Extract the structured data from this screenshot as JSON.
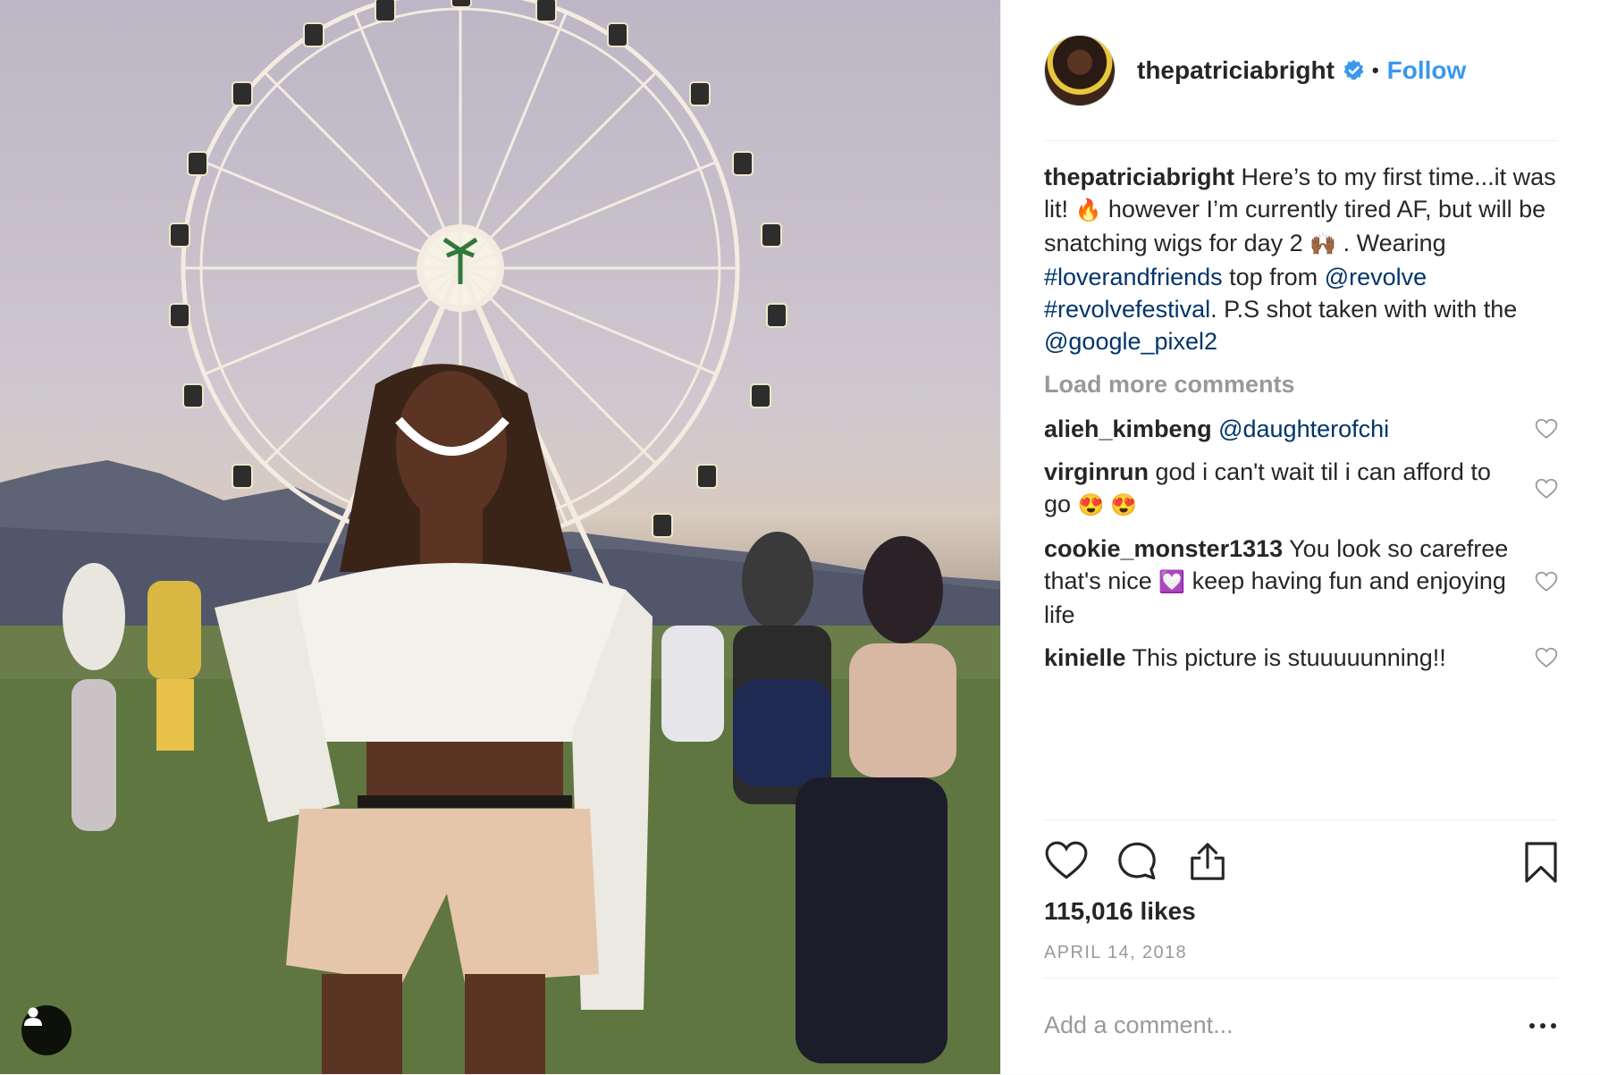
{
  "post": {
    "username": "thepatriciabright",
    "verified": true,
    "dot": "•",
    "follow_label": "Follow",
    "caption": {
      "t1": "Here’s to my first time...it was lit! ",
      "e1": "🔥",
      "t2": "  however I’m currently tired AF, but will be snatching wigs for day 2 ",
      "e2": "🙌🏾",
      "t3": " . Wearing ",
      "h1": "#loverandfriends",
      "t4": " top from ",
      "m1": "@revolve",
      "t5": " ",
      "h2": "#revolvefestival",
      "t6": ". P.S shot taken with with the ",
      "m2": "@google_pixel2"
    },
    "load_more_label": "Load more comments",
    "comments": [
      {
        "username": "alieh_kimbeng",
        "mention": "@daughterofchi"
      },
      {
        "username": "virginrun",
        "text": "god i can't wait til i can afford to go ",
        "emoji": "😍 😍"
      },
      {
        "username": "cookie_monster1313",
        "text_a": "You look so carefree that's nice ",
        "emoji": "💟",
        "text_b": " keep having fun and enjoying life"
      },
      {
        "username": "kinielle",
        "text": "This picture is stuuuuunning!!"
      }
    ],
    "likes": "115,016 likes",
    "date": "APRIL 14, 2018",
    "comment_placeholder": "Add a comment...",
    "more_label": "•••"
  },
  "icons": {
    "verified": "verified-badge-icon",
    "like": "heart-icon",
    "comment": "comment-bubble-icon",
    "share": "share-upload-icon",
    "save": "bookmark-icon",
    "tag": "user-tag-icon",
    "more": "more-options-icon"
  },
  "colors": {
    "follow": "#3897f0",
    "link": "#003569",
    "muted": "#999999",
    "text": "#262626",
    "verified": "#3897f0"
  }
}
